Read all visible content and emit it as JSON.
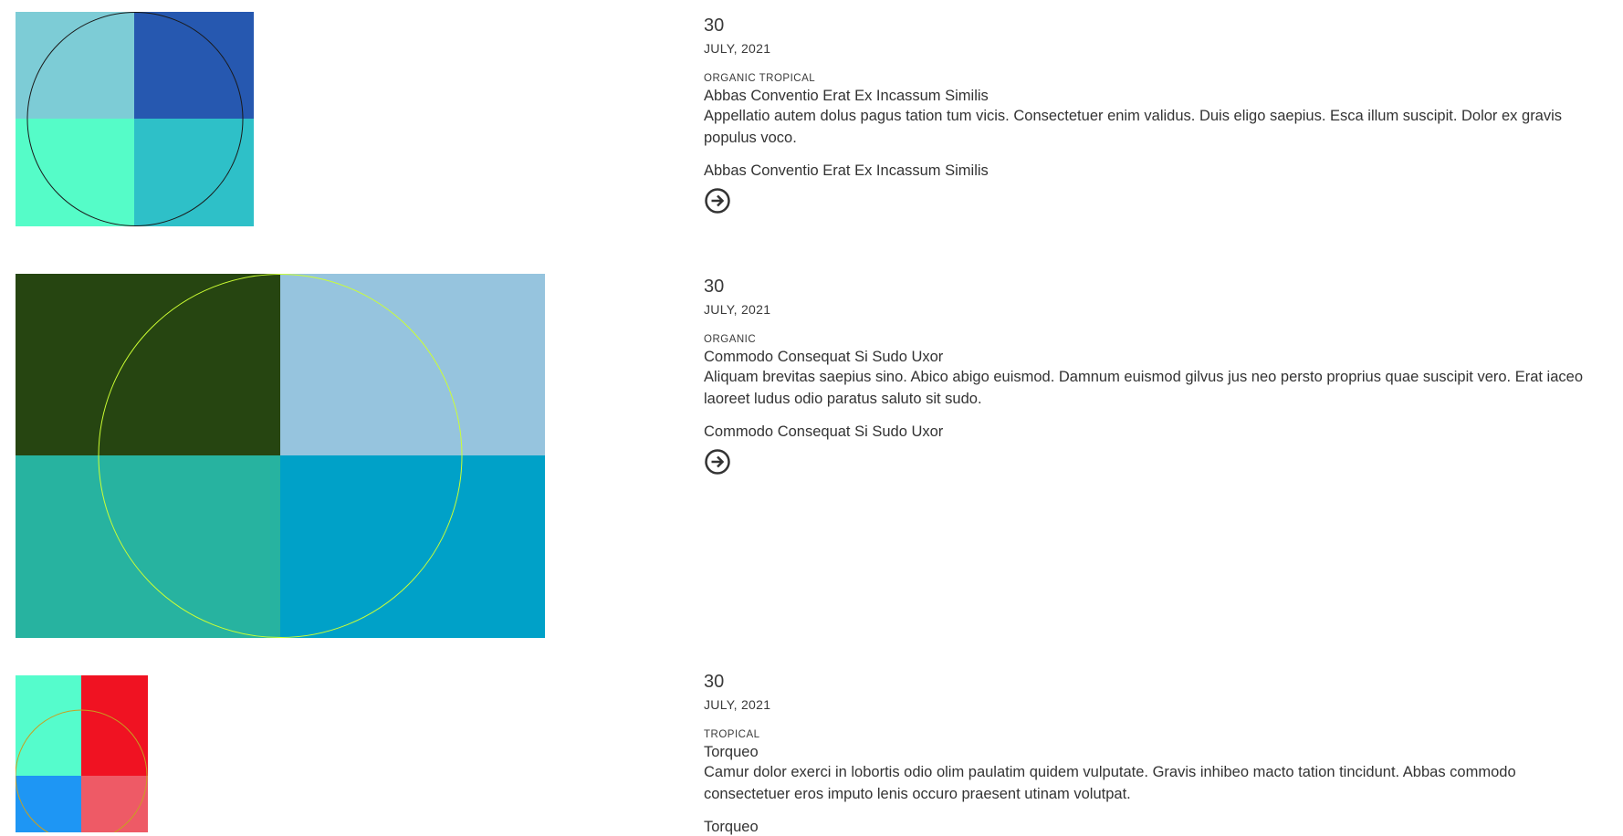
{
  "articles": [
    {
      "day": "30",
      "month": "JULY, 2021",
      "category": "ORGANIC TROPICAL",
      "title": "Abbas Conventio Erat Ex Incassum Similis",
      "excerpt": "Appellatio autem dolus pagus tation tum vicis. Consectetuer enim validus. Duis eligo saepius. Esca illum suscipit. Dolor ex gravis populus voco.",
      "link_label": "Abbas Conventio Erat Ex Incassum Similis",
      "arrow_icon": "arrow-right-circle-icon",
      "colors": {
        "tl": "#7dccd6",
        "tr": "#2658b0",
        "bl": "#55fcc8",
        "br": "#2ec0c8",
        "circle": "#1a1a1a"
      }
    },
    {
      "day": "30",
      "month": "JULY, 2021",
      "category": "ORGANIC",
      "title": "Commodo Consequat Si Sudo Uxor",
      "excerpt": "Aliquam brevitas saepius sino. Abico abigo euismod. Damnum euismod gilvus jus neo persto proprius quae suscipit vero. Erat iaceo laoreet ludus odio paratus saluto sit sudo.",
      "link_label": "Commodo Consequat Si Sudo Uxor",
      "arrow_icon": "arrow-right-circle-icon",
      "colors": {
        "tl": "#264511",
        "tr": "#96c4de",
        "bl": "#27b3a0",
        "br": "#00a1c8",
        "circle": "#ccff33"
      }
    },
    {
      "day": "30",
      "month": "JULY, 2021",
      "category": "TROPICAL",
      "title": "Torqueo",
      "excerpt": "Camur dolor exerci in lobortis odio olim paulatim quidem vulputate. Gravis inhibeo macto tation tincidunt. Abbas commodo consectetuer eros imputo lenis occuro praesent utinam volutpat.",
      "link_label": "Torqueo",
      "arrow_icon": "arrow-right-circle-icon",
      "colors": {
        "tl": "#55fccc",
        "tr": "#f01222",
        "bl": "#1e96f4",
        "br": "#ee5a66",
        "circle": "#c8a020"
      }
    }
  ]
}
